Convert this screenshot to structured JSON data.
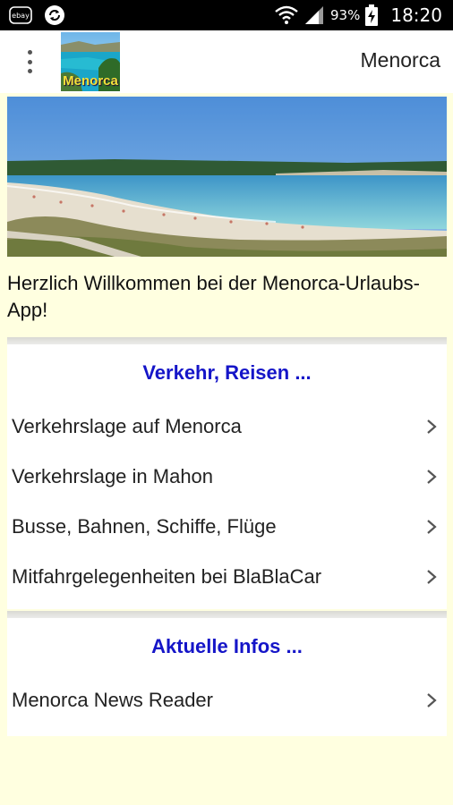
{
  "status_bar": {
    "left_icons": [
      "ebay-kleinanzeigen-icon",
      "sync-icon"
    ],
    "battery_percent": "93%",
    "time": "18:20",
    "right_icons": [
      "wifi-icon",
      "signal-icon",
      "battery-charging-icon"
    ]
  },
  "app_bar": {
    "menu_icon": "overflow-menu-icon",
    "logo_text": "Menorca",
    "title": "Menorca"
  },
  "welcome_text": "Herzlich Willkommen bei der Menorca-Urlaubs-App!",
  "sections": [
    {
      "heading": "Verkehr, Reisen ...",
      "items": [
        {
          "label": "Verkehrslage auf Menorca"
        },
        {
          "label": "Verkehrslage in Mahon"
        },
        {
          "label": "Busse, Bahnen, Schiffe, Flüge"
        },
        {
          "label": "Mitfahrgelegenheiten bei BlaBlaCar"
        }
      ]
    },
    {
      "heading": "Aktuelle Infos ...",
      "items": [
        {
          "label": "Menorca News Reader"
        }
      ]
    }
  ],
  "colors": {
    "background": "#FFFFE0",
    "heading": "#1515C8",
    "status_bar": "#000000"
  }
}
